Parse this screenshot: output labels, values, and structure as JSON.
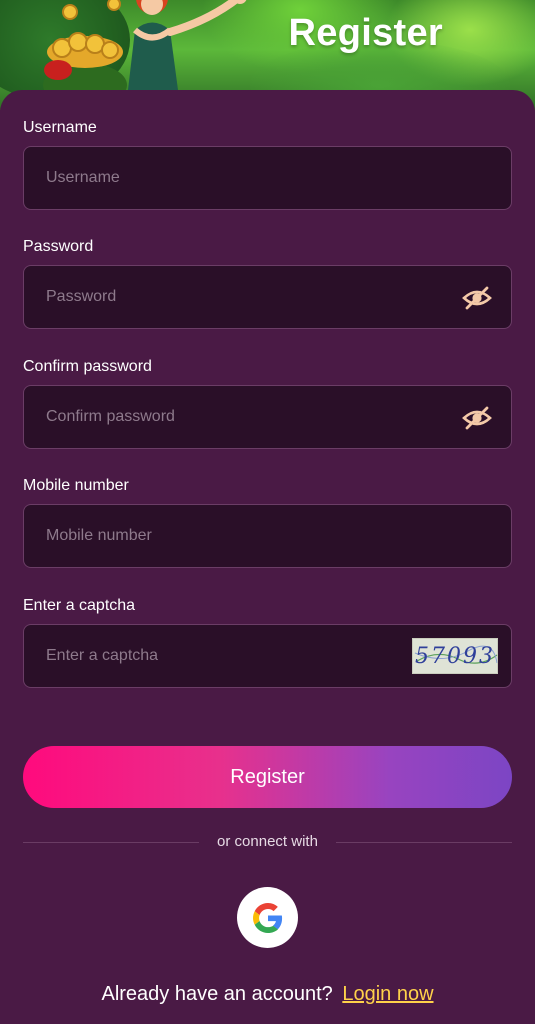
{
  "header": {
    "title": "Register"
  },
  "form": {
    "username": {
      "label": "Username",
      "placeholder": "Username",
      "value": ""
    },
    "password": {
      "label": "Password",
      "placeholder": "Password",
      "value": ""
    },
    "confirm_password": {
      "label": "Confirm password",
      "placeholder": "Confirm password",
      "value": ""
    },
    "mobile": {
      "label": "Mobile number",
      "placeholder": "Mobile number",
      "value": ""
    },
    "captcha": {
      "label": "Enter a captcha",
      "placeholder": "Enter a captcha",
      "value": "",
      "image_text": "57093"
    },
    "password_toggle_icon": "eye-slash-icon",
    "submit_label": "Register"
  },
  "social": {
    "divider_text": "or connect with",
    "google_icon": "google-icon"
  },
  "footer": {
    "prompt": "Already have an account?",
    "login_label": "Login now"
  },
  "colors": {
    "panel_bg": "#4a1a45",
    "field_bg": "#2a0f28",
    "button_gradient_start": "#ff0a7d",
    "button_gradient_end": "#7c45c4",
    "link": "#ffd24a"
  }
}
